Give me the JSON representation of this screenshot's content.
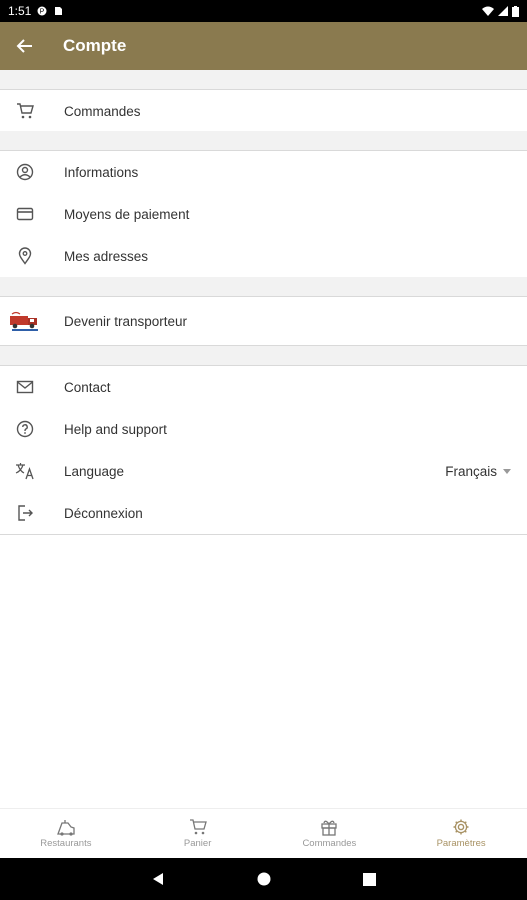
{
  "status_bar": {
    "time": "1:51"
  },
  "header": {
    "title": "Compte"
  },
  "groups": {
    "orders": {
      "label": "Commandes"
    },
    "account": {
      "informations": "Informations",
      "payment": "Moyens de paiement",
      "addresses": "Mes adresses"
    },
    "partner": {
      "label": "Devenir transporteur"
    },
    "support": {
      "contact": "Contact",
      "help": "Help and support",
      "language": "Language",
      "language_value": "Français",
      "logout": "Déconnexion"
    }
  },
  "bottom_nav": {
    "items": [
      {
        "label": "Restaurants",
        "icon": "restaurant-icon"
      },
      {
        "label": "Panier",
        "icon": "cart-icon"
      },
      {
        "label": "Commandes",
        "icon": "gift-icon"
      },
      {
        "label": "Paramètres",
        "icon": "gear-icon"
      }
    ],
    "active_index": 3,
    "active_color": "#a89264"
  },
  "colors": {
    "app_bar": "#8a7a4f",
    "accent": "#a89264"
  }
}
